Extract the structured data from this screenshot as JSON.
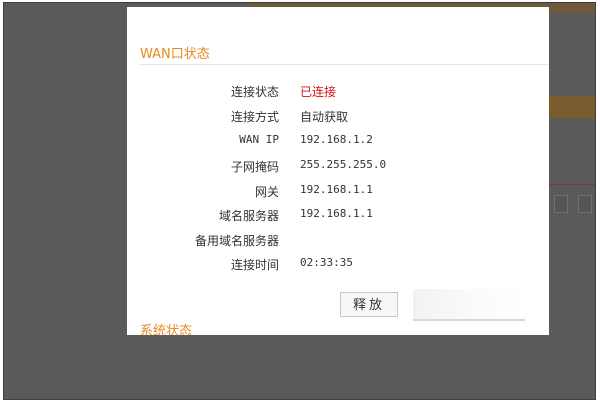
{
  "wan_section": {
    "title": "WAN口状态",
    "rows": [
      {
        "label": "连接状态",
        "value": "已连接"
      },
      {
        "label": "连接方式",
        "value": "自动获取"
      },
      {
        "label": "WAN IP",
        "value": "192.168.1.2"
      },
      {
        "label": "子网掩码",
        "value": "255.255.255.0"
      },
      {
        "label": "网关",
        "value": "192.168.1.1"
      },
      {
        "label": "域名服务器",
        "value": "192.168.1.1"
      },
      {
        "label": "备用域名服务器",
        "value": ""
      },
      {
        "label": "连接时间",
        "value": "02:33:35"
      }
    ]
  },
  "buttons": {
    "release_label": "释放"
  },
  "system_section": {
    "title": "系统状态"
  },
  "colors": {
    "accent": "#e8891f",
    "connected_red": "#d21414"
  }
}
